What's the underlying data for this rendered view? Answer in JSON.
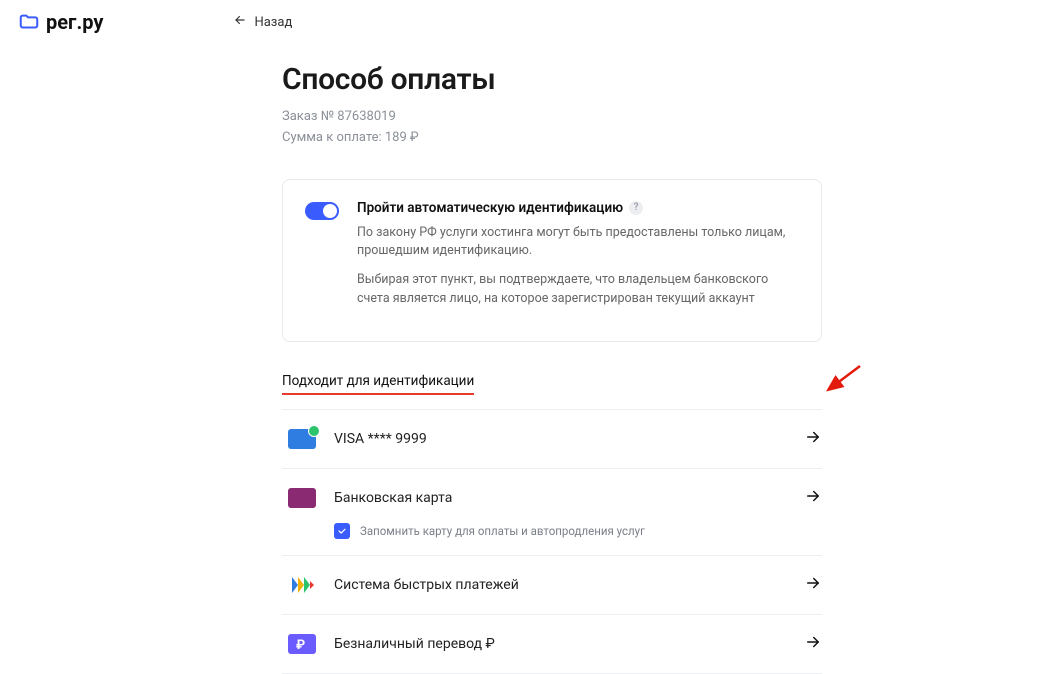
{
  "brand": {
    "name": "рег.ру"
  },
  "nav": {
    "back_label": "Назад"
  },
  "page": {
    "title": "Способ оплаты",
    "order_line": "Заказ № 87638019",
    "amount_line": "Сумма к оплате: 189 ₽"
  },
  "identification": {
    "title": "Пройти автоматическую идентификацию",
    "p1": "По закону РФ услуги хостинга могут быть предоставлены только лицам, прошедшим идентификацию.",
    "p2": "Выбирая этот пункт, вы подтверждаете, что владельцем банковского счета является лицо, на которое зарегистрирован текущий аккаунт",
    "toggle_on": true
  },
  "section_label": "Подходит для идентификации",
  "methods": [
    {
      "id": "saved-card",
      "label": "VISA **** 9999",
      "icon": "card1"
    },
    {
      "id": "bank-card",
      "label": "Банковская карта",
      "icon": "card2"
    },
    {
      "id": "sbp",
      "label": "Система быстрых платежей",
      "icon": "sbp"
    },
    {
      "id": "wire",
      "label": "Безналичный перевод ₽",
      "icon": "bank"
    }
  ],
  "remember": {
    "checked": true,
    "label": "Запомнить карту для оплаты и автопродления услуг"
  }
}
